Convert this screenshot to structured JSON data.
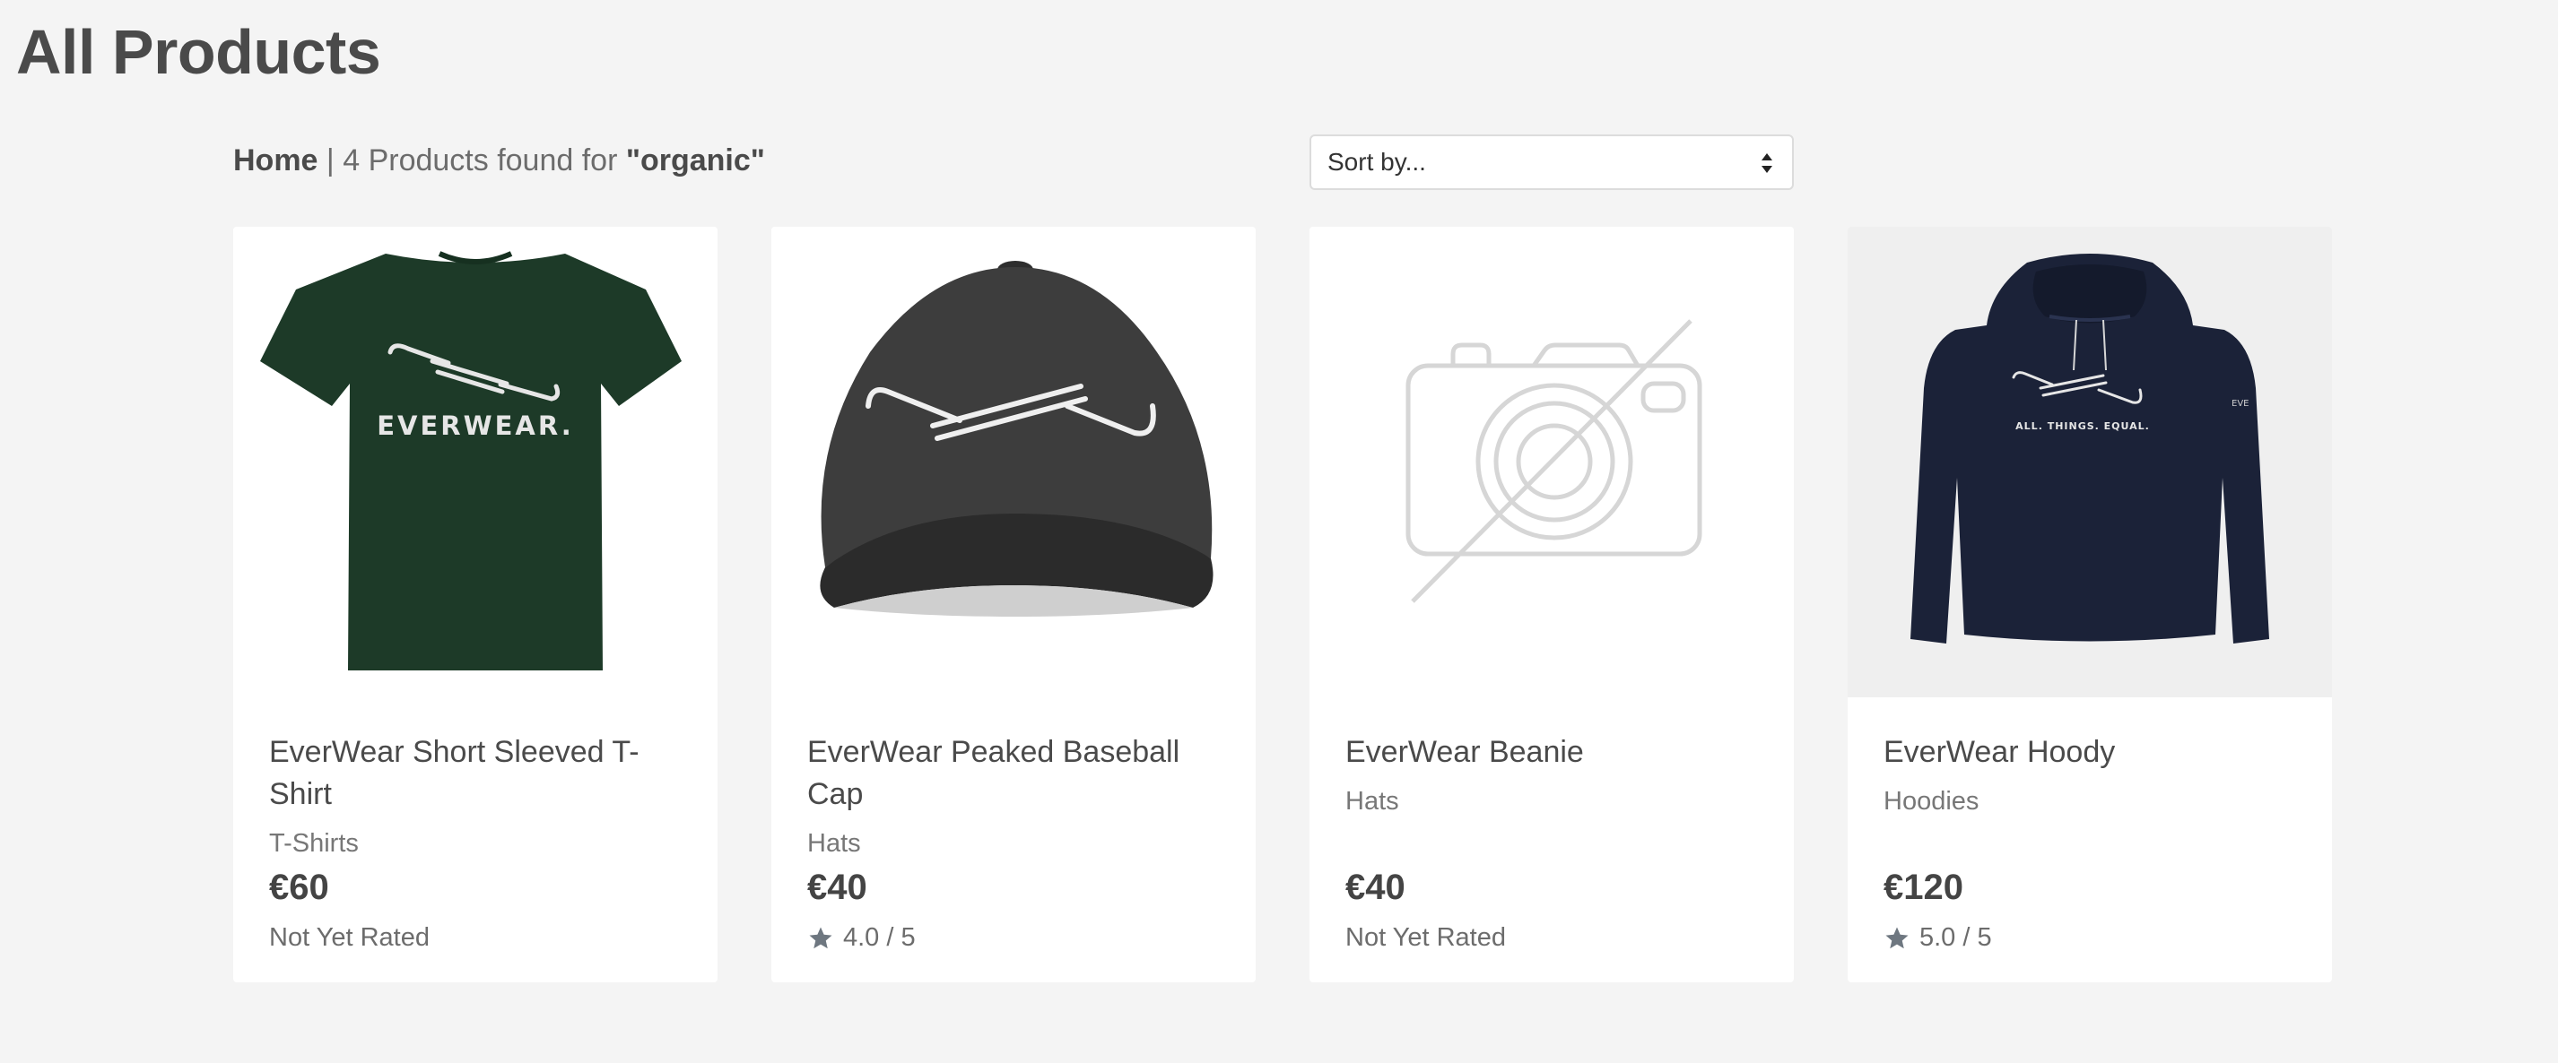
{
  "page": {
    "title": "All Products"
  },
  "breadcrumb": {
    "home": "Home",
    "separator": "|",
    "found_text": "4 Products found for",
    "search_term": "\"organic\""
  },
  "sort": {
    "selected": "Sort by..."
  },
  "products": [
    {
      "name": "EverWear Short Sleeved T-Shirt",
      "category": "T-Shirts",
      "price": "€60",
      "rating": "Not Yet Rated",
      "image": "tshirt-image",
      "logo_text": "EVERWEAR.",
      "color": "#1d3a28"
    },
    {
      "name": "EverWear Peaked Baseball Cap",
      "category": "Hats",
      "price": "€40",
      "rating": "4.0 / 5",
      "image": "cap-image",
      "color": "#3a3a3a"
    },
    {
      "name": "EverWear Beanie",
      "category": "Hats",
      "price": "€40",
      "rating": "Not Yet Rated",
      "image": "no-image-placeholder"
    },
    {
      "name": "EverWear Hoody",
      "category": "Hoodies",
      "price": "€120",
      "rating": "5.0 / 5",
      "image": "hoody-image",
      "logo_text": "ALL. THINGS. EQUAL.",
      "sleeve_text": "EVE",
      "color": "#1b2238"
    }
  ],
  "icons": {
    "star": "star-icon",
    "sort": "sort-arrows-icon"
  }
}
